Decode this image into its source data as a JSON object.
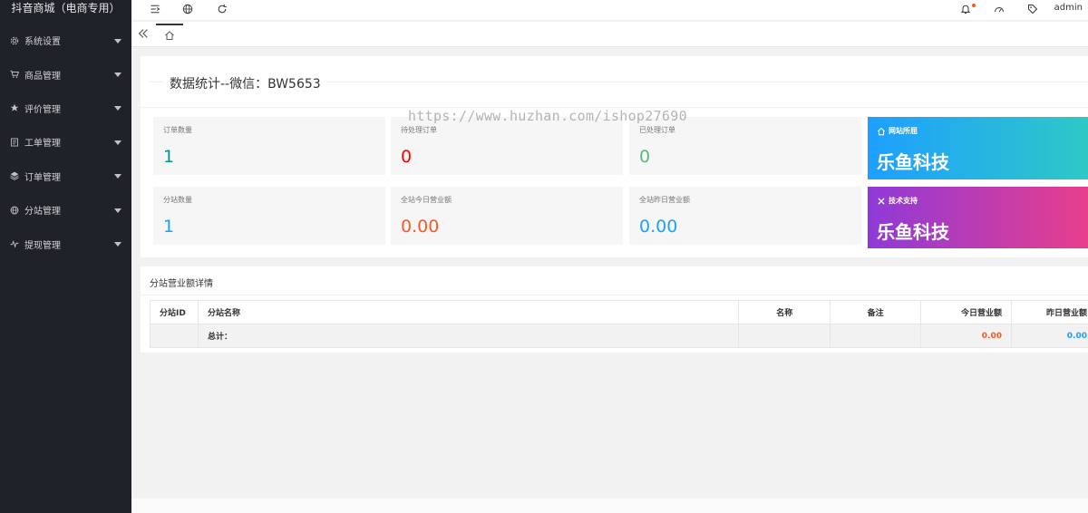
{
  "app": {
    "title": "抖音商城（电商专用）"
  },
  "sidebar": {
    "items": [
      {
        "label": "系统设置",
        "icon": "gear-icon"
      },
      {
        "label": "商品管理",
        "icon": "cart-icon"
      },
      {
        "label": "评价管理",
        "icon": "star-icon"
      },
      {
        "label": "工单管理",
        "icon": "document-icon"
      },
      {
        "label": "订单管理",
        "icon": "layers-icon"
      },
      {
        "label": "分站管理",
        "icon": "globe-icon"
      },
      {
        "label": "提现管理",
        "icon": "pulse-icon"
      }
    ]
  },
  "header": {
    "icons": [
      "menu-fold-icon",
      "globe-icon",
      "refresh-icon",
      "bell-icon",
      "dashboard-icon",
      "tag-icon"
    ],
    "user": "admin"
  },
  "tabs": {
    "home_icon": "home-icon",
    "collapse_icon": "double-chevron-left-icon"
  },
  "stats": {
    "title": "数据统计--微信：BW5653",
    "cards": [
      {
        "label": "订单数量",
        "value": "1",
        "color": "#009688"
      },
      {
        "label": "待处理订单",
        "value": "0",
        "color": "#ff0000"
      },
      {
        "label": "已处理订单",
        "value": "0",
        "color": "#5fb878"
      },
      {
        "label": "分站数量",
        "value": "1",
        "color": "#1e9fff"
      },
      {
        "label": "全站今日营业额",
        "value": "0.00",
        "color": "#ff5722"
      },
      {
        "label": "全站昨日营业额",
        "value": "0.00",
        "color": "#1e9fff"
      }
    ]
  },
  "promos": [
    {
      "label": "网站所屈",
      "text": "乐鱼科技",
      "icon": "home-icon",
      "gradient": [
        "#1e9fff",
        "#2ec8c6"
      ]
    },
    {
      "label": "技术支持",
      "text": "乐鱼科技",
      "icon": "tools-icon",
      "gradient": [
        "#8e3ad8",
        "#e83e8c"
      ]
    }
  ],
  "detail": {
    "title": "分站营业额详情",
    "columns": [
      "分站ID",
      "分站名称",
      "名称",
      "备注",
      "今日营业额",
      "昨日营业额"
    ],
    "summary": {
      "label": "总计：",
      "today": "0.00",
      "yesterday": "0.00"
    },
    "today_color": "#ff5722",
    "yesterday_color": "#1e9fff"
  },
  "watermark": "https://www.huzhan.com/ishop27690"
}
